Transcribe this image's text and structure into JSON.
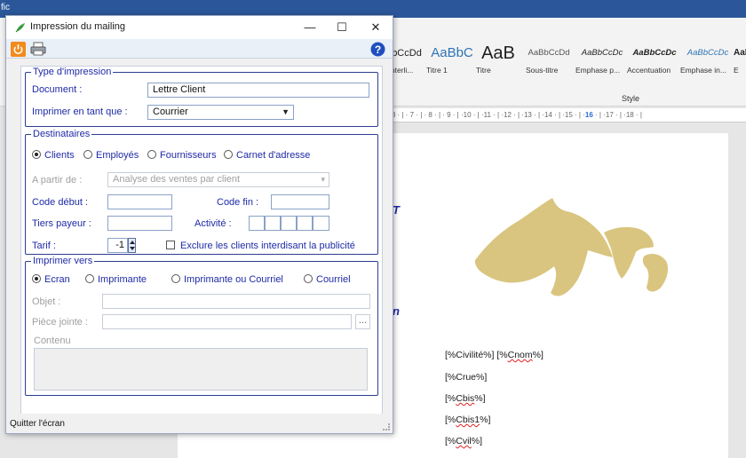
{
  "background_app": {
    "title_fragment": "fic",
    "styles": [
      {
        "preview": "bCcDd",
        "label": "interli..."
      },
      {
        "preview": "AaBbC",
        "label": "Titre 1"
      },
      {
        "preview": "AaB",
        "label": "Titre"
      },
      {
        "preview": "AaBbCcDd",
        "label": "Sous-titre"
      },
      {
        "preview": "AaBbCcDc",
        "label": "Emphase p..."
      },
      {
        "preview": "AaBbCcDc",
        "label": "Accentuation"
      },
      {
        "preview": "AaBbCcDc",
        "label": "Emphase in..."
      },
      {
        "preview": "AaBl",
        "label": "E"
      }
    ],
    "style_group_label": "Style",
    "ruler_text": "· 8 · | · 7 · | · 8 · | · 9 · | ·10 · | ·11 · | ·12 · | ·13 · | ·14 · | ·15 · | ·",
    "ruler_mark": "16",
    "ruler_tail": " · | ·17 · | ·18 · |",
    "edge_chars": [
      "T",
      "n"
    ],
    "merge_fields": [
      "[%Civilité%] [%Cnom%]",
      "[%Crue%]",
      "[%Cbis%]",
      "[%Cbis1%]",
      "[%Cvil%]"
    ],
    "colors": {
      "logo": "#d9c57f",
      "word_blue": "#2b579a"
    }
  },
  "dialog": {
    "title": "Impression du mailing",
    "window_buttons": {
      "minimize": "—",
      "maximize": "☐",
      "close": "✕"
    },
    "type_group": {
      "legend": "Type d'impression",
      "document_label": "Document :",
      "document_value": "Lettre Client",
      "print_as_label": "Imprimer en tant que :",
      "print_as_value": "Courrier"
    },
    "recipients_group": {
      "legend": "Destinataires",
      "options": [
        {
          "label": "Clients",
          "checked": true
        },
        {
          "label": "Employés",
          "checked": false
        },
        {
          "label": "Fournisseurs",
          "checked": false
        },
        {
          "label": "Carnet d'adresse",
          "checked": false
        }
      ],
      "from_label": "A partir de :",
      "from_value": "Analyse des ventes par client",
      "code_start_label": "Code début :",
      "code_end_label": "Code fin :",
      "third_payer_label": "Tiers payeur :",
      "activity_label": "Activité :",
      "tariff_label": "Tarif :",
      "tariff_value": "-1",
      "exclude_label": "Exclure les clients interdisant la publicité"
    },
    "print_to_group": {
      "legend": "Imprimer vers",
      "options": [
        {
          "label": "Ecran",
          "checked": true
        },
        {
          "label": "Imprimante",
          "checked": false
        },
        {
          "label": "Imprimante ou Courriel",
          "checked": false
        },
        {
          "label": "Courriel",
          "checked": false
        }
      ],
      "subject_label": "Objet :",
      "attachment_label": "Pièce jointe :",
      "browse_label": "...",
      "content_label": "Contenu"
    },
    "status_text": "Quitter l'écran",
    "colors": {
      "label_blue": "#1f2aa6",
      "border_navy": "#2d3d8f",
      "quit_orange": "#f28b1c"
    }
  }
}
